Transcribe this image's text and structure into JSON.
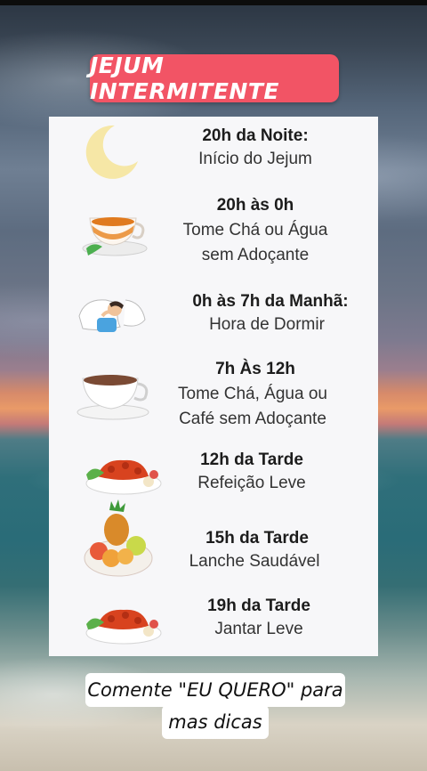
{
  "title": "JEJUM INTERMITENTE",
  "schedule": [
    {
      "time": "20h da Noite:",
      "desc_lines": [
        "Início do Jejum"
      ],
      "icon": "moon-icon"
    },
    {
      "time": "20h às 0h",
      "desc_lines": [
        "Tome Chá ou Água",
        "sem Adoçante"
      ],
      "icon": "tea-cup-icon"
    },
    {
      "time": "0h às 7h da Manhã:",
      "desc_lines": [
        "Hora de Dormir"
      ],
      "icon": "sleeping-person-icon"
    },
    {
      "time": "7h Às 12h",
      "desc_lines": [
        "Tome Chá, Água ou",
        "Café sem Adoçante"
      ],
      "icon": "coffee-cup-icon"
    },
    {
      "time": "12h da Tarde",
      "desc_lines": [
        "Refeição Leve"
      ],
      "icon": "meal-plate-icon"
    },
    {
      "time": "15h da Tarde",
      "desc_lines": [
        "Lanche Saudável"
      ],
      "icon": "fruit-plate-icon"
    },
    {
      "time": "19h da Tarde",
      "desc_lines": [
        "Jantar Leve"
      ],
      "icon": "dinner-plate-icon"
    }
  ],
  "footer": {
    "line1": "Comente \"EU QUERO\" para",
    "line2": "mas dicas"
  },
  "colors": {
    "title_bg": "#f25465",
    "card_bg": "#f7f7f9",
    "text": "#222222"
  }
}
